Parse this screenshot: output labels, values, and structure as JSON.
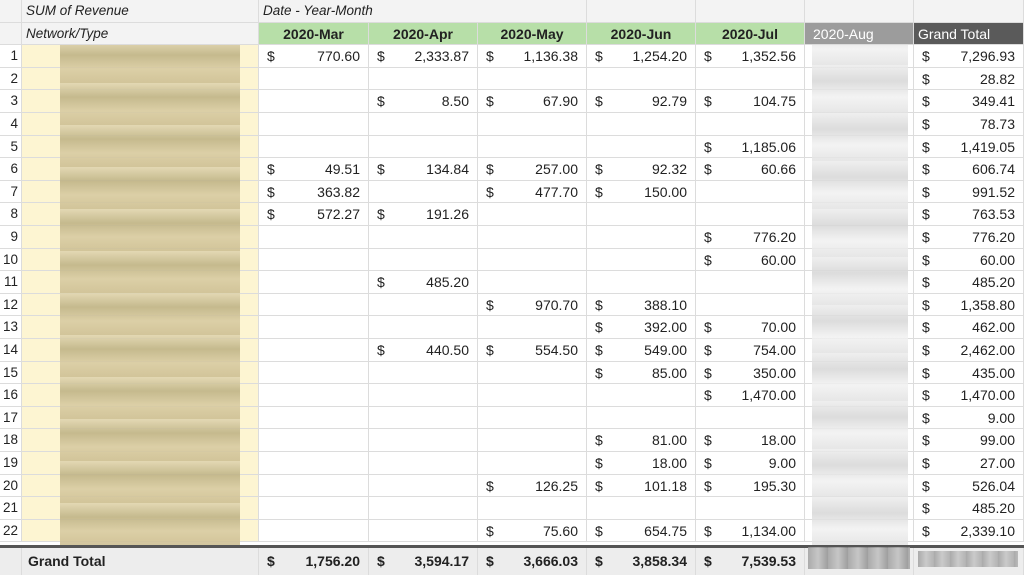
{
  "pivot": {
    "value_label": "SUM of  Revenue",
    "column_field": "Date - Year-Month",
    "row_field": "Network/Type",
    "months": [
      "2020-Mar",
      "2020-Apr",
      "2020-May",
      "2020-Jun",
      "2020-Jul",
      "2020-Aug"
    ],
    "grand_total_header": "Grand Total",
    "grand_total_label": "Grand Total",
    "currency": "$",
    "rows": [
      {
        "n": "1",
        "vals": [
          "770.60",
          "2,333.87",
          "1,136.38",
          "1,254.20",
          "1,352.56"
        ],
        "total": "7,296.93"
      },
      {
        "n": "2",
        "vals": [
          "",
          "",
          "",
          "",
          ""
        ],
        "total": "28.82"
      },
      {
        "n": "3",
        "vals": [
          "",
          "8.50",
          "67.90",
          "92.79",
          "104.75"
        ],
        "total": "349.41"
      },
      {
        "n": "4",
        "vals": [
          "",
          "",
          "",
          "",
          ""
        ],
        "total": "78.73"
      },
      {
        "n": "5",
        "vals": [
          "",
          "",
          "",
          "",
          "1,185.06"
        ],
        "total": "1,419.05"
      },
      {
        "n": "6",
        "vals": [
          "49.51",
          "134.84",
          "257.00",
          "92.32",
          "60.66"
        ],
        "total": "606.74"
      },
      {
        "n": "7",
        "vals": [
          "363.82",
          "",
          "477.70",
          "150.00",
          ""
        ],
        "total": "991.52"
      },
      {
        "n": "8",
        "vals": [
          "572.27",
          "191.26",
          "",
          "",
          ""
        ],
        "total": "763.53"
      },
      {
        "n": "9",
        "vals": [
          "",
          "",
          "",
          "",
          "776.20"
        ],
        "total": "776.20"
      },
      {
        "n": "10",
        "vals": [
          "",
          "",
          "",
          "",
          "60.00"
        ],
        "total": "60.00"
      },
      {
        "n": "11",
        "vals": [
          "",
          "485.20",
          "",
          "",
          ""
        ],
        "total": "485.20"
      },
      {
        "n": "12",
        "vals": [
          "",
          "",
          "970.70",
          "388.10",
          ""
        ],
        "total": "1,358.80"
      },
      {
        "n": "13",
        "vals": [
          "",
          "",
          "",
          "392.00",
          "70.00"
        ],
        "total": "462.00"
      },
      {
        "n": "14",
        "vals": [
          "",
          "440.50",
          "554.50",
          "549.00",
          "754.00"
        ],
        "total": "2,462.00"
      },
      {
        "n": "15",
        "vals": [
          "",
          "",
          "",
          "85.00",
          "350.00"
        ],
        "total": "435.00"
      },
      {
        "n": "16",
        "vals": [
          "",
          "",
          "",
          "",
          "1,470.00"
        ],
        "total": "1,470.00"
      },
      {
        "n": "17",
        "vals": [
          "",
          "",
          "",
          "",
          ""
        ],
        "total": "9.00"
      },
      {
        "n": "18",
        "vals": [
          "",
          "",
          "",
          "81.00",
          "18.00"
        ],
        "total": "99.00"
      },
      {
        "n": "19",
        "vals": [
          "",
          "",
          "",
          "18.00",
          "9.00"
        ],
        "total": "27.00"
      },
      {
        "n": "20",
        "vals": [
          "",
          "",
          "126.25",
          "101.18",
          "195.30"
        ],
        "total": "526.04"
      },
      {
        "n": "21",
        "vals": [
          "",
          "",
          "",
          "",
          ""
        ],
        "total": "485.20"
      },
      {
        "n": "22",
        "vals": [
          "",
          "",
          "75.60",
          "654.75",
          "1,134.00"
        ],
        "total": "2,339.10"
      }
    ],
    "grand_totals": [
      "1,756.20",
      "3,594.17",
      "3,666.03",
      "3,858.34",
      "7,539.53"
    ],
    "colors": {
      "month_header_bg": "#b7dfa8",
      "aug_header_bg": "#9c9c9c",
      "grand_header_bg": "#5a5a5a",
      "label_column_bg": "#fdf5d2",
      "grand_total_row_bg": "#ededed",
      "top_header_bg": "#f3f3f3"
    }
  }
}
